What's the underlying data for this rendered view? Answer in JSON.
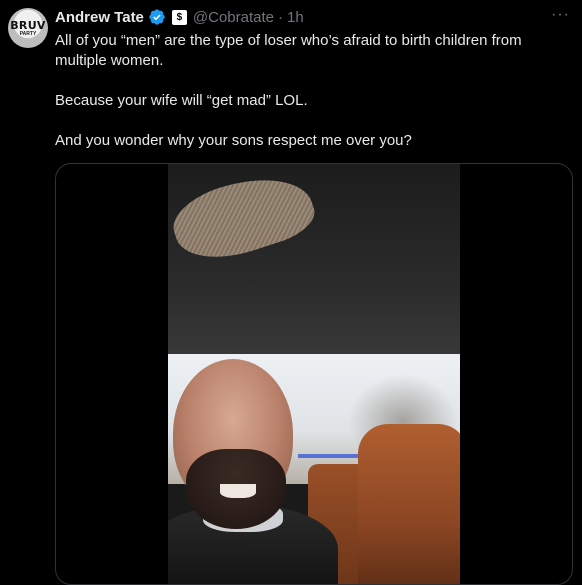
{
  "tweet": {
    "avatar_text": "BRUV",
    "avatar_subtext": "PARTY",
    "author_name": "Andrew Tate",
    "handle": "@Cobratate",
    "separator": "·",
    "time": "1h",
    "more_label": "···",
    "affiliate_badge": "$",
    "body": [
      "All of you “men” are the type of loser who’s afraid to birth children from multiple women.",
      "Because your wife will “get mad” LOL.",
      "And you wonder why your sons respect me over you?"
    ]
  },
  "colors": {
    "background": "#000000",
    "text_primary": "#e7e9ea",
    "text_secondary": "#71767b",
    "verified_blue": "#1d9bf0",
    "border": "#2f3336"
  },
  "icons": {
    "verified": "verified-badge-icon",
    "affiliate": "affiliate-badge-icon",
    "more": "more-options-icon"
  }
}
